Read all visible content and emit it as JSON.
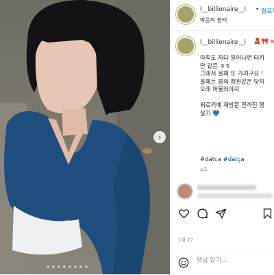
{
  "post": {
    "username": "l__billionaire__l",
    "separator": "•",
    "follow_label": "팔로우",
    "location": "마음의 쉼터",
    "caption_emojis": "🧸🎀🍬",
    "caption": "아직도 자다 일어나면 터키\n만 같은 ㅎㅎ\n그래서 올해 또 가려구요 !\n올해는 꼽의 정원같은 닷차\n오래 머물러야지\n\n튀르키예 재방문 전까진 행\n살기 💙",
    "hashtags": "#datca #datça",
    "time_ago": "4주",
    "date": "1월 17"
  },
  "comment": {
    "placeholder": "댓글 달기..."
  },
  "carousel": {
    "next_glyph": "›",
    "slide_count": 9,
    "active_slide": 1
  },
  "icons": [
    "heart-icon",
    "comment-icon",
    "share-icon",
    "bookmark-icon",
    "emoji-icon",
    "chevron-right-icon"
  ],
  "colors": {
    "link": "#0095f6",
    "hashtag": "#00376b",
    "sweater": "#1f4e7e"
  }
}
